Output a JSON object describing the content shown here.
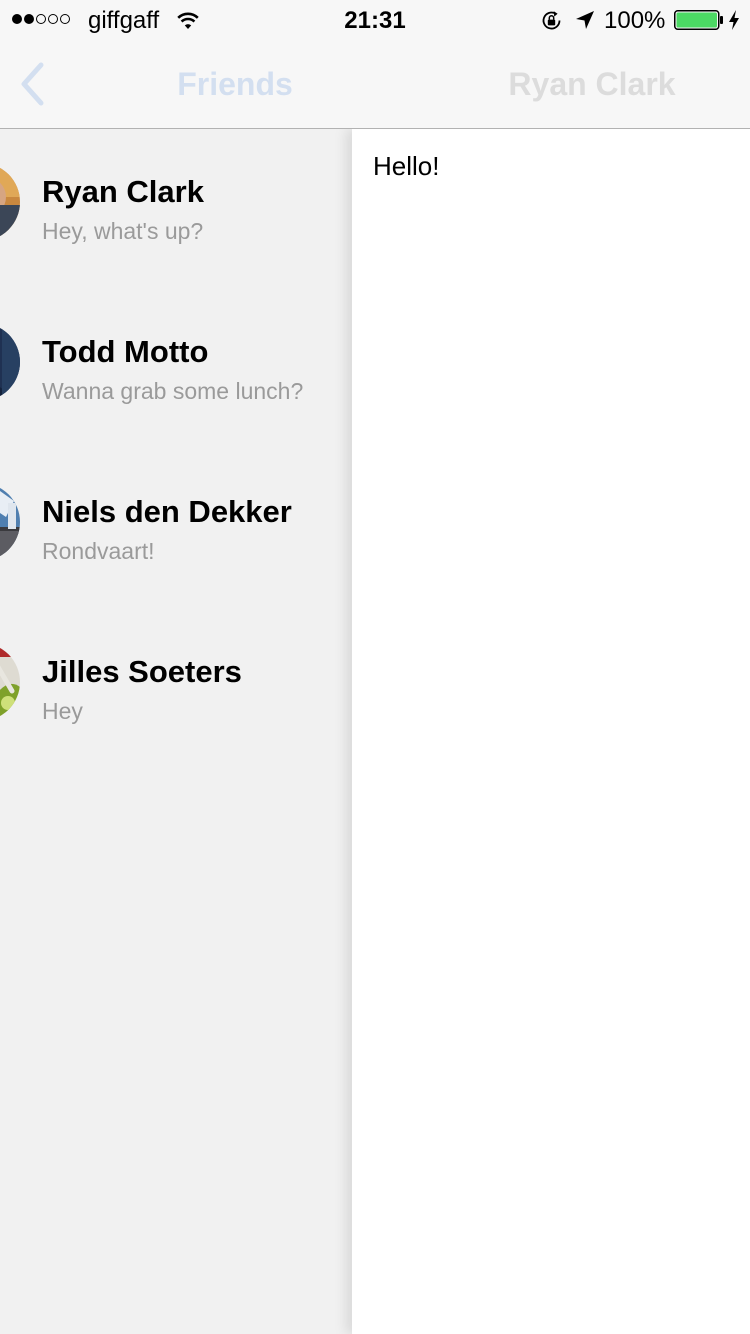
{
  "status_bar": {
    "carrier": "giffgaff",
    "signal_bars_filled": 2,
    "signal_bars_total": 5,
    "time": "21:31",
    "battery_percent": "100%",
    "battery_level": 1.0,
    "icons": [
      "wifi-icon",
      "lock-rotation-icon",
      "location-icon",
      "battery-icon",
      "charging-icon"
    ]
  },
  "nav": {
    "back_icon": "chevron-left-icon",
    "left_title": "Friends",
    "right_title": "Ryan Clark",
    "accent_color": "#d3dff0"
  },
  "friends": [
    {
      "name": "Ryan Clark",
      "last_message": "Hey, what's up?"
    },
    {
      "name": "Todd Motto",
      "last_message": "Wanna grab some lunch?"
    },
    {
      "name": "Niels den Dekker",
      "last_message": "Rondvaart!"
    },
    {
      "name": "Jilles Soeters",
      "last_message": "Hey"
    }
  ],
  "chat": {
    "message": "Hello!"
  }
}
